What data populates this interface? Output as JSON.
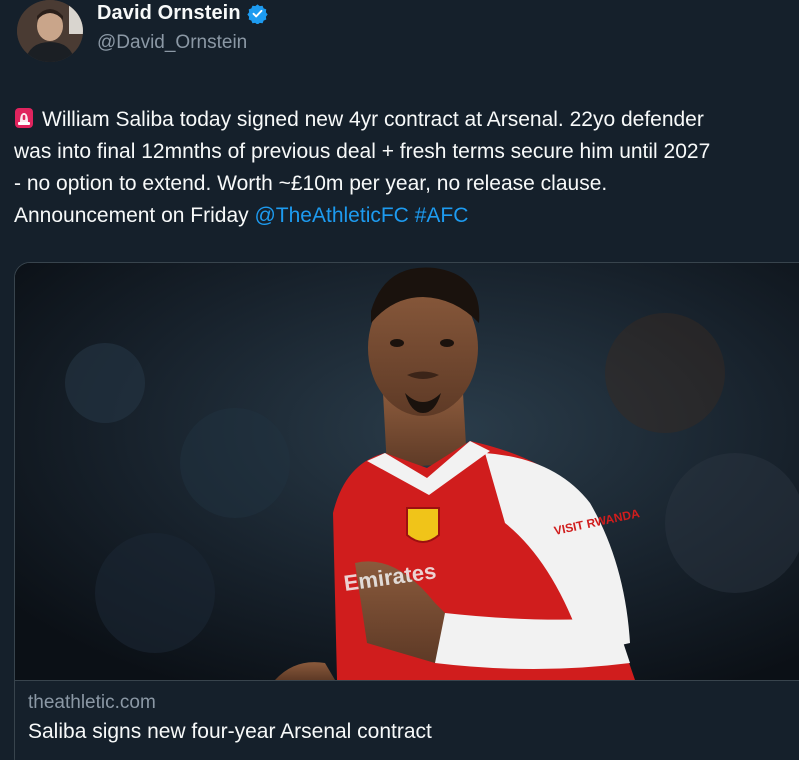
{
  "author": {
    "display_name": "David Ornstein",
    "handle": "@David_Ornstein",
    "verified": true,
    "avatar_icon": "profile-photo"
  },
  "tweet": {
    "lines": [
      "William Saliba today signed new 4yr contract at Arsenal. 22yo defender",
      "was into final 12mnths of previous deal + fresh terms secure him until 2027",
      "- no option to extend. Worth ~£10m per year, no release clause."
    ],
    "last_line_prefix": "Announcement on Friday ",
    "mention": "@TheAthleticFC",
    "hashtag": "#AFC",
    "leading_emoji": "rotating-light-icon"
  },
  "card": {
    "image_icon": "player-photo",
    "domain": "theathletic.com",
    "title": "Saliba signs new four-year Arsenal contract",
    "jersey_sponsor": "Emirates",
    "sleeve_text": "VISIT RWANDA"
  },
  "colors": {
    "background": "#15202b",
    "link": "#1d9bf0",
    "secondary_text": "#8b98a5",
    "arsenal_red": "#d01d1d"
  }
}
